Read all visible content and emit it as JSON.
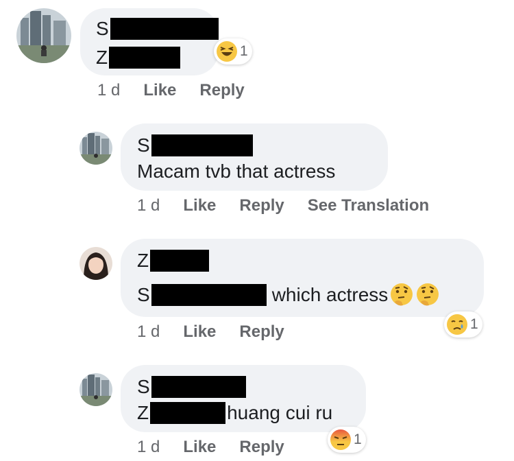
{
  "comments": [
    {
      "name_initial": "S",
      "text_prefix": "Z",
      "text_suffix": "",
      "reaction_icon": "laughing-face-icon",
      "reaction_count": "1",
      "time": "1 d",
      "like": "Like",
      "reply": "Reply"
    },
    {
      "name_initial": "S",
      "text": "Macam tvb that actress",
      "time": "1 d",
      "like": "Like",
      "reply": "Reply",
      "translate": "See Translation"
    },
    {
      "name_initial": "Z",
      "text_prefix": "S",
      "text_suffix": "which actress",
      "inline_emojis": [
        "thinking-face-icon",
        "thinking-face-icon"
      ],
      "reaction_icon": "crying-face-icon",
      "reaction_count": "1",
      "time": "1 d",
      "like": "Like",
      "reply": "Reply"
    },
    {
      "name_initial": "S",
      "text_prefix": "Z",
      "text_suffix": "huang cui ru",
      "reaction_icon": "angry-face-icon",
      "reaction_count": "1",
      "time": "1 d",
      "like": "Like",
      "reply": "Reply"
    }
  ],
  "colors": {
    "bubble": "#f0f2f5",
    "meta_text": "#65676b",
    "text": "#1c1e21",
    "reaction_yellow": "#f7c744",
    "reaction_angry": "#e9573f"
  }
}
